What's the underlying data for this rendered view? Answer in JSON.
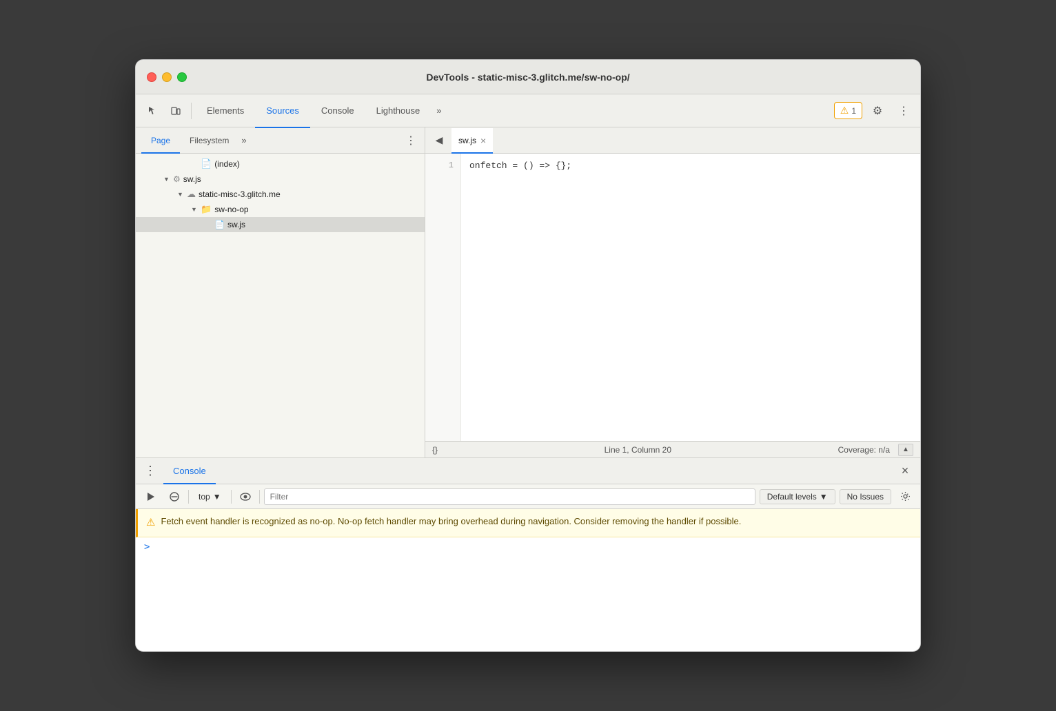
{
  "window": {
    "title": "DevTools - static-misc-3.glitch.me/sw-no-op/"
  },
  "top_toolbar": {
    "tabs": [
      {
        "id": "elements",
        "label": "Elements",
        "active": false
      },
      {
        "id": "sources",
        "label": "Sources",
        "active": true
      },
      {
        "id": "console",
        "label": "Console",
        "active": false
      },
      {
        "id": "lighthouse",
        "label": "Lighthouse",
        "active": false
      }
    ],
    "more_tabs_label": "»",
    "warning_badge": "1",
    "settings_icon": "⚙",
    "more_icon": "⋮"
  },
  "left_panel": {
    "sub_tabs": [
      {
        "id": "page",
        "label": "Page",
        "active": true
      },
      {
        "id": "filesystem",
        "label": "Filesystem",
        "active": false
      }
    ],
    "sub_tab_more": "»",
    "menu_icon": "⋮",
    "file_tree": [
      {
        "indent": 80,
        "type": "file",
        "label": "(index)",
        "icon": "doc",
        "arrow": ""
      },
      {
        "indent": 40,
        "type": "gear-file",
        "label": "sw.js",
        "icon": "gear",
        "arrow": "▼"
      },
      {
        "indent": 60,
        "type": "cloud-folder",
        "label": "static-misc-3.glitch.me",
        "icon": "cloud",
        "arrow": "▼"
      },
      {
        "indent": 80,
        "type": "folder",
        "label": "sw-no-op",
        "icon": "folder",
        "arrow": "▼"
      },
      {
        "indent": 100,
        "type": "js-file",
        "label": "sw.js",
        "icon": "js",
        "arrow": "",
        "selected": true
      }
    ]
  },
  "editor": {
    "sidebar_toggle_icon": "◀",
    "tab_name": "sw.js",
    "tab_close": "×",
    "code_lines": [
      {
        "number": "1",
        "content": "onfetch = () => {};"
      }
    ]
  },
  "status_bar": {
    "format_icon": "{}",
    "position": "Line 1, Column 20",
    "coverage": "Coverage: n/a",
    "scroll_icon": "▲"
  },
  "bottom_panel": {
    "menu_icon": "⋮",
    "tab_name": "Console",
    "close_icon": "×",
    "console_toolbar": {
      "run_icon": "▶",
      "clear_icon": "🚫",
      "context_label": "top",
      "context_arrow": "▼",
      "eye_icon": "👁",
      "filter_placeholder": "Filter",
      "levels_label": "Default levels",
      "levels_arrow": "▼",
      "no_issues_label": "No Issues",
      "settings_icon": "⚙"
    },
    "warning_message": "Fetch event handler is recognized as no-op. No-op fetch handler may bring overhead during navigation. Consider removing the handler if possible.",
    "prompt_symbol": ">"
  }
}
